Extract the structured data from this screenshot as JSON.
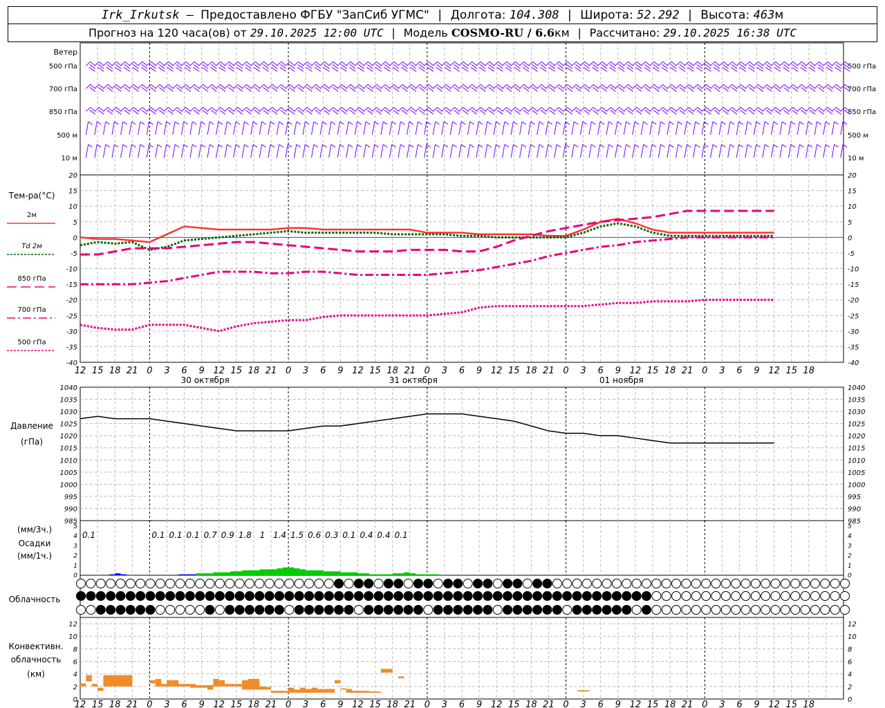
{
  "header": {
    "station": "Irk_Irkutsk",
    "dash": " — ",
    "provider": "Предоставлено ФГБУ \"ЗапСиб УГМС\"",
    "sep": " | ",
    "lon_label": "Долгота: ",
    "lon": "104.308",
    "lat_label": "Широта: ",
    "lat": "52.292",
    "alt_label": "Высота: ",
    "alt": "463",
    "alt_unit": "м"
  },
  "header2": {
    "fc_label": "Прогноз на 120 часа(ов) от ",
    "fc_time": "29.10.2025 12:00 UTC",
    "model_label": "Модель ",
    "model": "COSMO-RU / 6.6",
    "model_unit": "км",
    "calc_label": "Рассчитано: ",
    "calc_time": "29.10.2025 16:38 UTC"
  },
  "panel_labels": {
    "wind": "Ветер",
    "levels": [
      "500 гПа",
      "700 гПа",
      "850 гПа",
      "500 м",
      "10 м"
    ],
    "temp": "Тем-ра(°С)",
    "temp_legend": [
      "2м",
      "Td  2м",
      "850 гПа",
      "700 гПа",
      "500 гПа"
    ],
    "pressure": "Давление",
    "pressure_unit": "(гПа)",
    "precip_unit3": "(мм/3ч.)",
    "precip": "Осадки",
    "precip_unit1": "(мм/1ч.)",
    "cloud": "Облачность",
    "conv1": "Конвективн.",
    "conv2": "облачность",
    "conv_unit": "(км)"
  },
  "colors": {
    "t2m": "#ff3333",
    "td2m": "#006400",
    "t850": "#e6007e",
    "wind": "#7a00ff",
    "precip": "#00cc00",
    "precip_snow": "#1111ff",
    "conv": "#f08c28"
  },
  "chart_data": [
    {
      "type": "line",
      "panel": "temperature",
      "ylabel": "Тем-ра(°С)",
      "ylim": [
        -40,
        20
      ],
      "yticks": [
        20,
        15,
        10,
        5,
        0,
        -5,
        -10,
        -15,
        -20,
        -25,
        -30,
        -35,
        -40
      ],
      "x_hours": [
        0,
        3,
        6,
        9,
        12,
        15,
        18,
        21,
        24,
        27,
        30,
        33,
        36,
        39,
        42,
        45,
        48,
        51,
        54,
        57,
        60,
        63,
        66,
        69,
        72,
        75,
        78,
        81,
        84,
        87,
        90,
        93,
        96,
        99,
        102,
        105,
        108,
        111,
        114,
        117,
        120
      ],
      "x_tick_labels": [
        "12",
        "15",
        "18",
        "21",
        "0",
        "3",
        "6",
        "9",
        "12",
        "15",
        "18",
        "21",
        "0",
        "3",
        "6",
        "9",
        "12",
        "15",
        "18",
        "21",
        "0",
        "3",
        "6",
        "9",
        "12",
        "15",
        "18",
        "21",
        "0",
        "3",
        "6",
        "9",
        "12",
        "15",
        "18",
        "21",
        "0",
        "3",
        "6",
        "9",
        "12",
        "15",
        "18"
      ],
      "date_labels": [
        "30 октября",
        "31 октября",
        "01 ноября"
      ],
      "series": [
        {
          "name": "2м",
          "values": [
            0,
            -0.5,
            -0.5,
            -1,
            -1.5,
            1,
            3.5,
            3,
            2.5,
            2.5,
            2.5,
            2.5,
            3,
            3,
            2.5,
            2.5,
            2.5,
            2.5,
            2.5,
            2.5,
            1.5,
            1.5,
            1.5,
            1,
            1,
            1,
            1,
            0.5,
            0.5,
            2.5,
            5,
            6,
            4.5,
            2.5,
            1.5,
            1.5,
            1.5,
            1.5,
            1.5,
            1.5,
            1.5
          ]
        },
        {
          "name": "Td  2м",
          "values": [
            -2.5,
            -1.5,
            -2,
            -1.5,
            -4,
            -3,
            -1,
            -0.5,
            0,
            0.5,
            1,
            1.5,
            2,
            1.5,
            1.5,
            1.5,
            1.5,
            1.5,
            1,
            1,
            1,
            1,
            0.5,
            0.5,
            0,
            0,
            0,
            0,
            0,
            1.5,
            3.5,
            4.5,
            3.5,
            1.5,
            0.5,
            0.5,
            0.5,
            0.5,
            0.5,
            0.5,
            0.5
          ]
        },
        {
          "name": "850 гПа",
          "values": [
            -5.5,
            -5.5,
            -4.5,
            -3.5,
            -3.5,
            -3.5,
            -3,
            -2.5,
            -2,
            -1.5,
            -1.5,
            -2,
            -2.5,
            -3,
            -3.5,
            -4,
            -4.5,
            -4.5,
            -4.5,
            -4,
            -4,
            -4,
            -4.5,
            -4.5,
            -3,
            -1,
            0.5,
            2,
            3,
            4,
            5,
            5.5,
            6,
            6.5,
            7.5,
            8.5,
            8.5,
            8.5,
            8.5,
            8.5,
            8.5
          ]
        },
        {
          "name": "700 гПа",
          "values": [
            -15,
            -15,
            -15,
            -15,
            -14.5,
            -14,
            -13,
            -12,
            -11,
            -11,
            -11,
            -11.5,
            -11.5,
            -11,
            -11,
            -11.5,
            -12,
            -12,
            -12,
            -12,
            -12,
            -11.5,
            -11,
            -10.5,
            -9.5,
            -8.5,
            -7.5,
            -6,
            -5,
            -4,
            -3,
            -2.5,
            -1.5,
            -1,
            -0.5,
            0,
            0,
            0,
            0,
            0,
            0
          ]
        },
        {
          "name": "500 гПа",
          "values": [
            -28,
            -29,
            -29.5,
            -29.5,
            -28,
            -28,
            -28,
            -29,
            -30,
            -28.5,
            -27.5,
            -27,
            -26.5,
            -26.5,
            -25.5,
            -25,
            -25,
            -25,
            -25,
            -25,
            -25,
            -24.5,
            -24,
            -22.5,
            -22,
            -22,
            -22,
            -22,
            -22,
            -22,
            -21.5,
            -21,
            -21,
            -20.5,
            -20.5,
            -20.5,
            -20,
            -20,
            -20,
            -20,
            -20
          ]
        }
      ]
    },
    {
      "type": "line",
      "panel": "pressure",
      "ylabel": "Давление",
      "ylim": [
        985,
        1040
      ],
      "yticks": [
        1040,
        1035,
        1030,
        1025,
        1020,
        1015,
        1010,
        1005,
        1000,
        995,
        990,
        985
      ],
      "series": [
        {
          "name": "",
          "values": [
            1027,
            1028,
            1027,
            1027,
            1027,
            1026,
            1025,
            1024,
            1023,
            1022,
            1022,
            1022,
            1022,
            1023,
            1024,
            1024,
            1025,
            1026,
            1027,
            1028,
            1029,
            1029,
            1029,
            1028,
            1027,
            1026,
            1024,
            1022,
            1021,
            1021,
            1020,
            1020,
            1019,
            1018,
            1017,
            1017,
            1017,
            1017,
            1017,
            1017,
            1017
          ]
        }
      ]
    },
    {
      "type": "bar",
      "panel": "precipitation",
      "ylim": [
        0,
        5
      ],
      "yticks": [
        5,
        4,
        3,
        2,
        1,
        0
      ],
      "three_hour_totals": [
        {
          "hour": 0,
          "label": "0.1"
        },
        {
          "hour": 12,
          "label": "0.1"
        },
        {
          "hour": 15,
          "label": "0.1"
        },
        {
          "hour": 18,
          "label": "0.1"
        },
        {
          "hour": 21,
          "label": "0.7"
        },
        {
          "hour": 24,
          "label": "0.9"
        },
        {
          "hour": 27,
          "label": "1.8"
        },
        {
          "hour": 30,
          "label": "1"
        },
        {
          "hour": 33,
          "label": "1.4"
        },
        {
          "hour": 36,
          "label": "1.5"
        },
        {
          "hour": 39,
          "label": "0.6"
        },
        {
          "hour": 42,
          "label": "0.3"
        },
        {
          "hour": 45,
          "label": "0.1"
        },
        {
          "hour": 48,
          "label": "0.4"
        },
        {
          "hour": 51,
          "label": "0.4"
        },
        {
          "hour": 54,
          "label": "0.1"
        }
      ],
      "hourly_values": [
        0,
        0.1,
        0.2,
        0.1,
        0,
        0,
        0,
        0,
        0,
        0,
        0,
        0,
        0,
        0.1,
        0.1,
        0.1,
        0.2,
        0.2,
        0.2,
        0.3,
        0.3,
        0.3,
        0.4,
        0.4,
        0.5,
        0.5,
        0.5,
        0.6,
        0.6,
        0.6,
        0.7,
        0.8,
        0.8,
        0.7,
        0.6,
        0.5,
        0.5,
        0.5,
        0.4,
        0.4,
        0.4,
        0.3,
        0.3,
        0.3,
        0.2,
        0.2,
        0.1,
        0.1,
        0.1,
        0.1,
        0.2,
        0.2,
        0.3,
        0.2,
        0.1,
        0.1,
        0.1,
        0.1,
        0
      ]
    },
    {
      "type": "bar",
      "panel": "convective_cloud",
      "ylim": [
        0,
        13
      ],
      "yticks": [
        12,
        10,
        8,
        6,
        4,
        2,
        0
      ],
      "segments": [
        {
          "h0": 0,
          "h1": 1,
          "base": 2,
          "top": 2.5
        },
        {
          "h0": 1,
          "h1": 2,
          "base": 2.8,
          "top": 3.8
        },
        {
          "h0": 2,
          "h1": 3,
          "base": 2,
          "top": 2.4
        },
        {
          "h0": 3,
          "h1": 4,
          "base": 1.3,
          "top": 1.8
        },
        {
          "h0": 4,
          "h1": 8,
          "base": 2,
          "top": 3.8
        },
        {
          "h0": 8,
          "h1": 9,
          "base": 2,
          "top": 3.8
        },
        {
          "h0": 12,
          "h1": 13,
          "base": 2.5,
          "top": 3.0
        },
        {
          "h0": 13,
          "h1": 14,
          "base": 2,
          "top": 3.2
        },
        {
          "h0": 14,
          "h1": 15,
          "base": 2,
          "top": 2.4
        },
        {
          "h0": 15,
          "h1": 16,
          "base": 2,
          "top": 3.0
        },
        {
          "h0": 16,
          "h1": 17,
          "base": 2,
          "top": 3.0
        },
        {
          "h0": 17,
          "h1": 18,
          "base": 2,
          "top": 2.4
        },
        {
          "h0": 18,
          "h1": 19,
          "base": 2,
          "top": 2.4
        },
        {
          "h0": 19,
          "h1": 20,
          "base": 1.8,
          "top": 2.4
        },
        {
          "h0": 20,
          "h1": 21,
          "base": 1.8,
          "top": 2.2
        },
        {
          "h0": 21,
          "h1": 22,
          "base": 1.8,
          "top": 2.2
        },
        {
          "h0": 22,
          "h1": 23,
          "base": 1.5,
          "top": 2.2
        },
        {
          "h0": 23,
          "h1": 24,
          "base": 2,
          "top": 3.2
        },
        {
          "h0": 24,
          "h1": 25,
          "base": 2,
          "top": 3.0
        },
        {
          "h0": 25,
          "h1": 26,
          "base": 2,
          "top": 2.4
        },
        {
          "h0": 26,
          "h1": 27,
          "base": 2,
          "top": 2.4
        },
        {
          "h0": 27,
          "h1": 28,
          "base": 2,
          "top": 2.4
        },
        {
          "h0": 28,
          "h1": 29,
          "base": 1.5,
          "top": 3.0
        },
        {
          "h0": 29,
          "h1": 31,
          "base": 1.5,
          "top": 3.2
        },
        {
          "h0": 31,
          "h1": 32,
          "base": 1.5,
          "top": 2.0
        },
        {
          "h0": 32,
          "h1": 33,
          "base": 1.5,
          "top": 1.9
        },
        {
          "h0": 33,
          "h1": 36,
          "base": 1,
          "top": 1.3
        },
        {
          "h0": 36,
          "h1": 37,
          "base": 1,
          "top": 1.8
        },
        {
          "h0": 37,
          "h1": 38,
          "base": 1,
          "top": 1.5
        },
        {
          "h0": 38,
          "h1": 39,
          "base": 1,
          "top": 1.8
        },
        {
          "h0": 39,
          "h1": 40,
          "base": 1,
          "top": 1.6
        },
        {
          "h0": 40,
          "h1": 41,
          "base": 1,
          "top": 1.8
        },
        {
          "h0": 41,
          "h1": 42,
          "base": 1,
          "top": 1.6
        },
        {
          "h0": 42,
          "h1": 43,
          "base": 1,
          "top": 1.6
        },
        {
          "h0": 43,
          "h1": 44,
          "base": 1,
          "top": 1.6
        },
        {
          "h0": 44,
          "h1": 45,
          "base": 2.5,
          "top": 3.0
        },
        {
          "h0": 45,
          "h1": 46,
          "base": 1.5,
          "top": 1.7
        },
        {
          "h0": 46,
          "h1": 47,
          "base": 1,
          "top": 1.6
        },
        {
          "h0": 47,
          "h1": 48,
          "base": 1,
          "top": 1.3
        },
        {
          "h0": 48,
          "h1": 50,
          "base": 1,
          "top": 1.3
        },
        {
          "h0": 50,
          "h1": 51,
          "base": 1,
          "top": 1.2
        },
        {
          "h0": 51,
          "h1": 52,
          "base": 1,
          "top": 1.2
        },
        {
          "h0": 52,
          "h1": 54,
          "base": 4.2,
          "top": 4.8
        },
        {
          "h0": 55,
          "h1": 56,
          "base": 3.3,
          "top": 3.6
        },
        {
          "h0": 86,
          "h1": 88,
          "base": 1.2,
          "top": 1.4
        }
      ]
    }
  ],
  "cloud_cover": {
    "rows": 3,
    "cols": 78
  }
}
